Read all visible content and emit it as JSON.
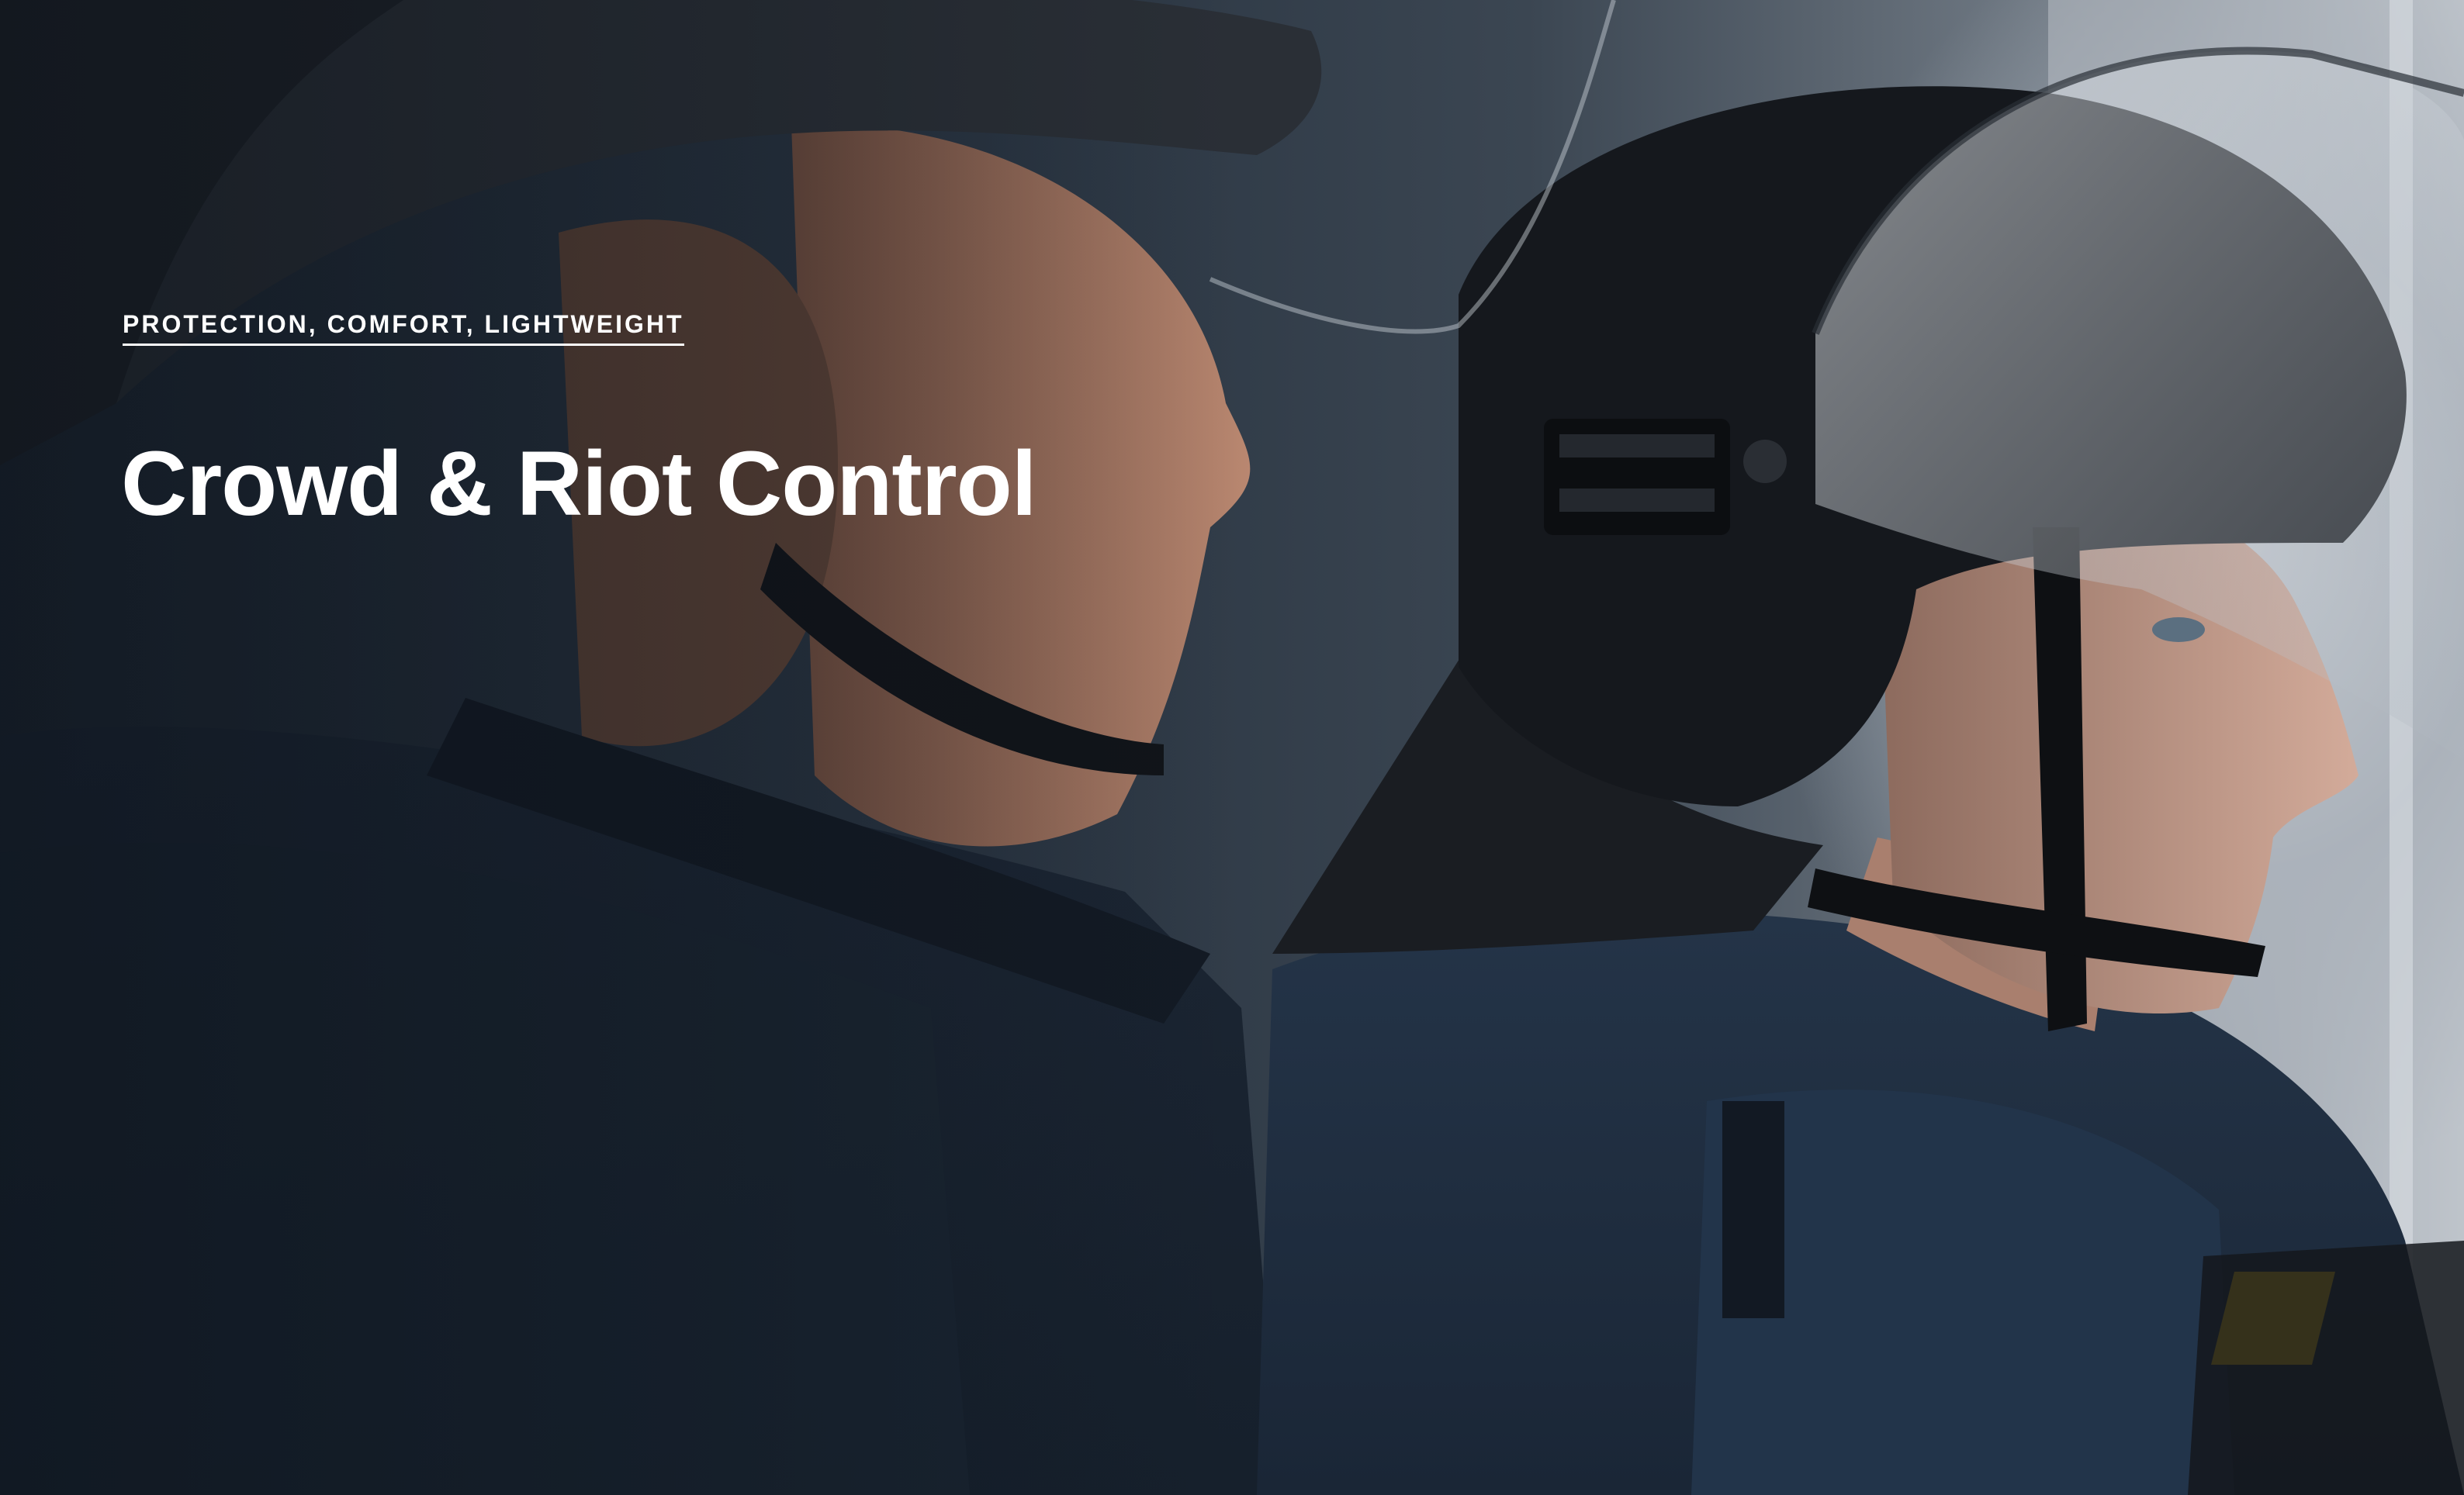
{
  "hero": {
    "eyebrow": "PROTECTION, COMFORT, LIGHTWEIGHT",
    "title": "Crowd & Riot Control"
  },
  "colors": {
    "text": "#ffffff",
    "uniform": "#1f2c3c",
    "helmet": "#15181d",
    "accent": "#f2c318"
  }
}
